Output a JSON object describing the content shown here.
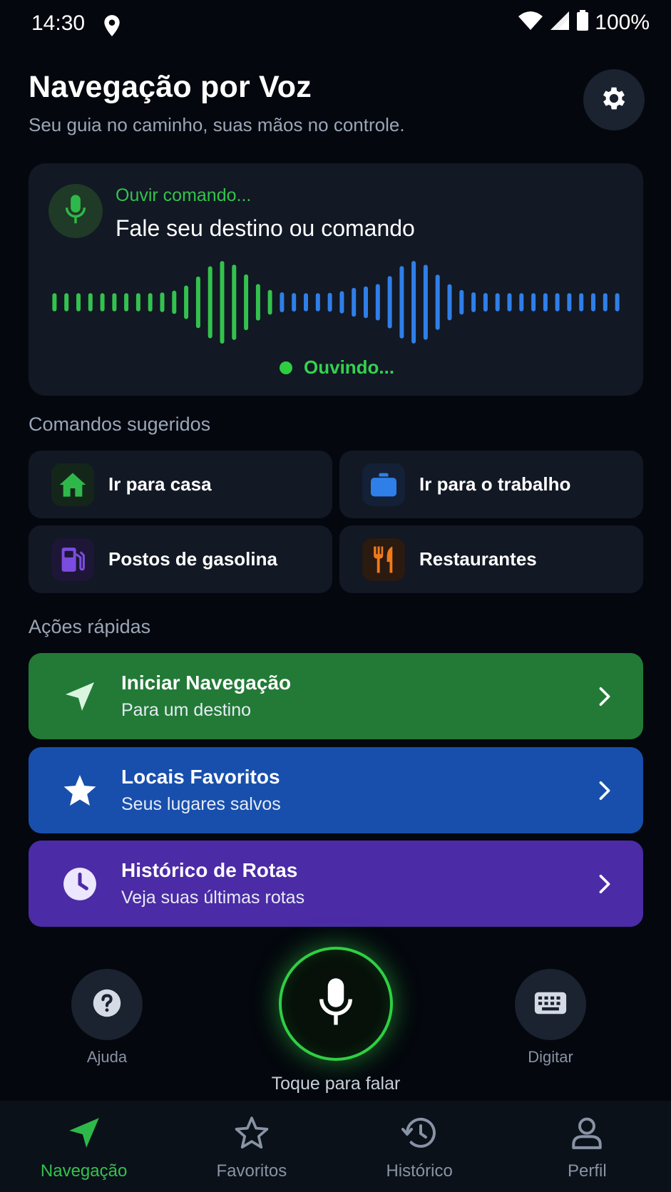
{
  "status_bar": {
    "time": "14:30",
    "battery": "100%"
  },
  "header": {
    "title": "Navegação por Voz",
    "subtitle": "Seu guia no caminho, suas mãos no controle."
  },
  "voice_card": {
    "state_label": "Ouvir comando...",
    "prompt": "Fale seu destino ou comando",
    "listening": "Ouvindo..."
  },
  "suggestions": {
    "heading": "Comandos sugeridos",
    "items": [
      {
        "label": "Ir para casa",
        "icon": "home-icon",
        "color": "#2fb84a"
      },
      {
        "label": "Ir para o trabalho",
        "icon": "briefcase-icon",
        "color": "#2f7fe8"
      },
      {
        "label": "Postos de gasolina",
        "icon": "gas-pump-icon",
        "color": "#7b4ce0"
      },
      {
        "label": "Restaurantes",
        "icon": "fork-knife-icon",
        "color": "#f07a1a"
      }
    ]
  },
  "quick_actions": {
    "heading": "Ações rápidas",
    "items": [
      {
        "title": "Iniciar Navegação",
        "subtitle": "Para um destino",
        "icon": "navigation-arrow-icon",
        "color": "#227a36"
      },
      {
        "title": "Locais Favoritos",
        "subtitle": "Seus lugares salvos",
        "icon": "star-icon",
        "color": "#184fad"
      },
      {
        "title": "Histórico de Rotas",
        "subtitle": "Veja suas últimas rotas",
        "icon": "clock-icon",
        "color": "#4b2ba6"
      }
    ]
  },
  "controls": {
    "help": "Ajuda",
    "type": "Digitar",
    "tap_to_speak": "Toque para falar"
  },
  "nav": {
    "items": [
      {
        "label": "Navegação",
        "icon": "navigation-arrow-icon",
        "active": true
      },
      {
        "label": "Favoritos",
        "icon": "star-outline-icon",
        "active": false
      },
      {
        "label": "Histórico",
        "icon": "history-icon",
        "active": false
      },
      {
        "label": "Perfil",
        "icon": "user-icon",
        "active": false
      }
    ]
  },
  "colors": {
    "accent_green": "#33c24d",
    "accent_blue": "#2f7fe8",
    "background": "#04070d",
    "card": "#121824"
  }
}
